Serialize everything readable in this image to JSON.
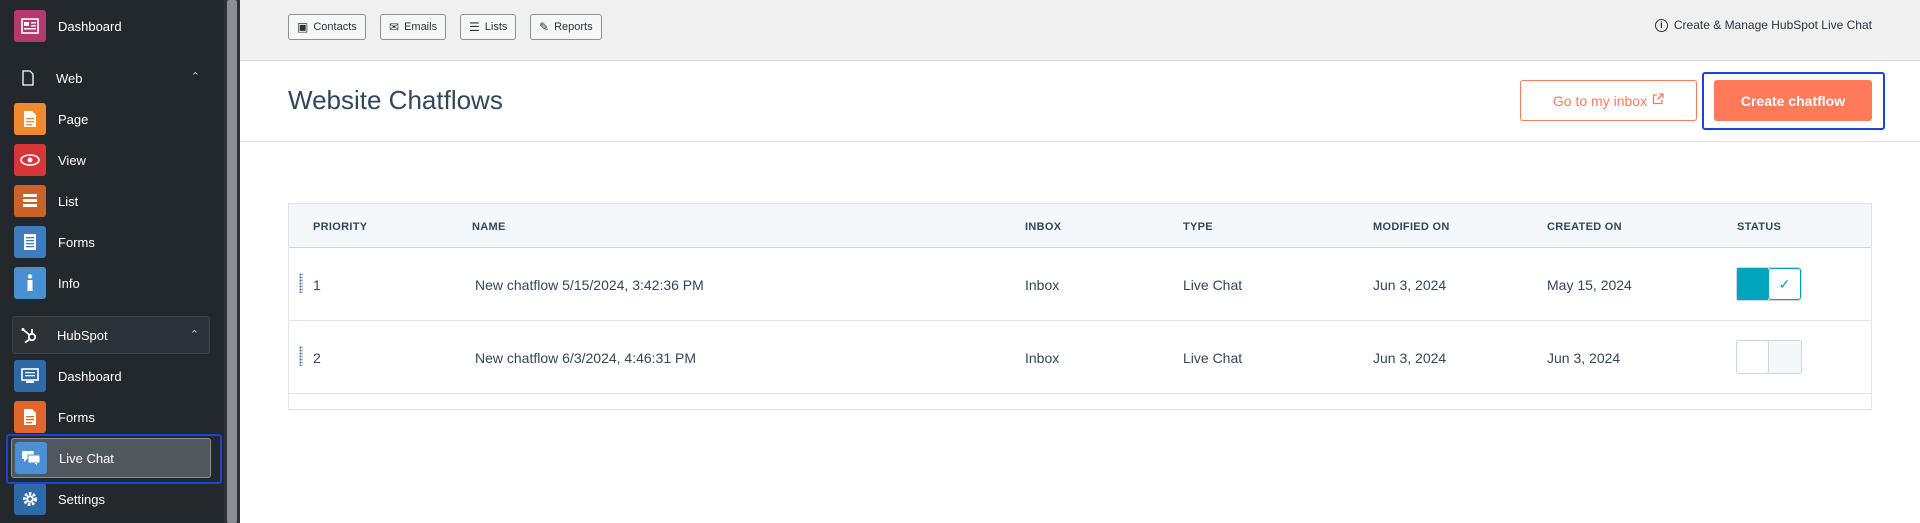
{
  "sidebar": {
    "dashboard": "Dashboard",
    "web_section": "Web",
    "web_items": [
      "Page",
      "View",
      "List",
      "Forms",
      "Info"
    ],
    "hubspot_section": "HubSpot",
    "hubspot_items": [
      "Dashboard",
      "Forms",
      "Live Chat",
      "Settings"
    ]
  },
  "topbar": {
    "buttons": [
      "Contacts",
      "Emails",
      "Lists",
      "Reports"
    ],
    "help_link": "Create & Manage HubSpot Live Chat"
  },
  "header": {
    "title": "Website Chatflows",
    "inbox_button": "Go to my inbox",
    "create_button": "Create chatflow"
  },
  "table": {
    "columns": [
      "PRIORITY",
      "NAME",
      "INBOX",
      "TYPE",
      "MODIFIED ON",
      "CREATED ON",
      "STATUS"
    ],
    "rows": [
      {
        "priority": "1",
        "name": "New chatflow 5/15/2024, 3:42:36 PM",
        "inbox": "Inbox",
        "type": "Live Chat",
        "modified": "Jun 3, 2024",
        "created": "May 15, 2024",
        "status_on": true
      },
      {
        "priority": "2",
        "name": "New chatflow 6/3/2024, 4:46:31 PM",
        "inbox": "Inbox",
        "type": "Live Chat",
        "modified": "Jun 3, 2024",
        "created": "Jun 3, 2024",
        "status_on": false
      }
    ]
  },
  "colors": {
    "accent": "#ff7a59",
    "toggle_on": "#00a4bd",
    "highlight": "#1a44d6"
  }
}
